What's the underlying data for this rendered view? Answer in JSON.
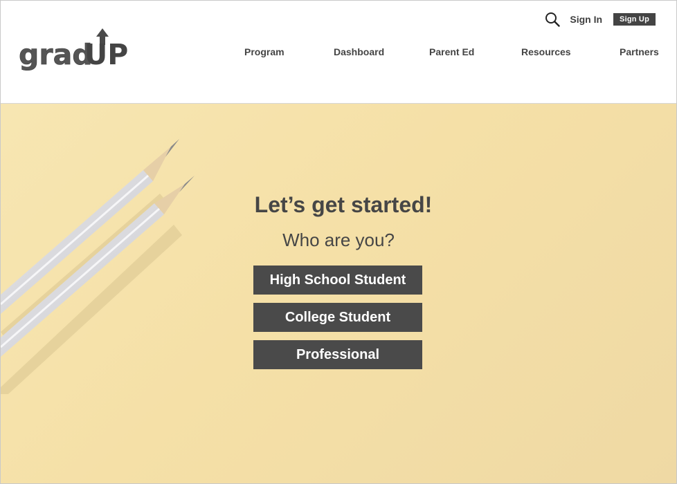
{
  "brand": {
    "logo_text_left": "grad",
    "logo_text_right": "UP",
    "logo_color": "#4a4a4a"
  },
  "topbar": {
    "search_icon": "search-icon",
    "signin_label": "Sign In",
    "signup_label": "Sign Up"
  },
  "nav": {
    "items": [
      {
        "label": "Program"
      },
      {
        "label": "Dashboard"
      },
      {
        "label": "Parent Ed"
      },
      {
        "label": "Resources"
      },
      {
        "label": "Partners"
      }
    ]
  },
  "hero": {
    "background_color": "#f5e0a7",
    "headline": "Let’s get started!",
    "subheadline": "Who are you?",
    "options": [
      {
        "label": "High School Student"
      },
      {
        "label": "College Student"
      },
      {
        "label": "Professional"
      }
    ],
    "button_color": "#4a4a4a"
  }
}
